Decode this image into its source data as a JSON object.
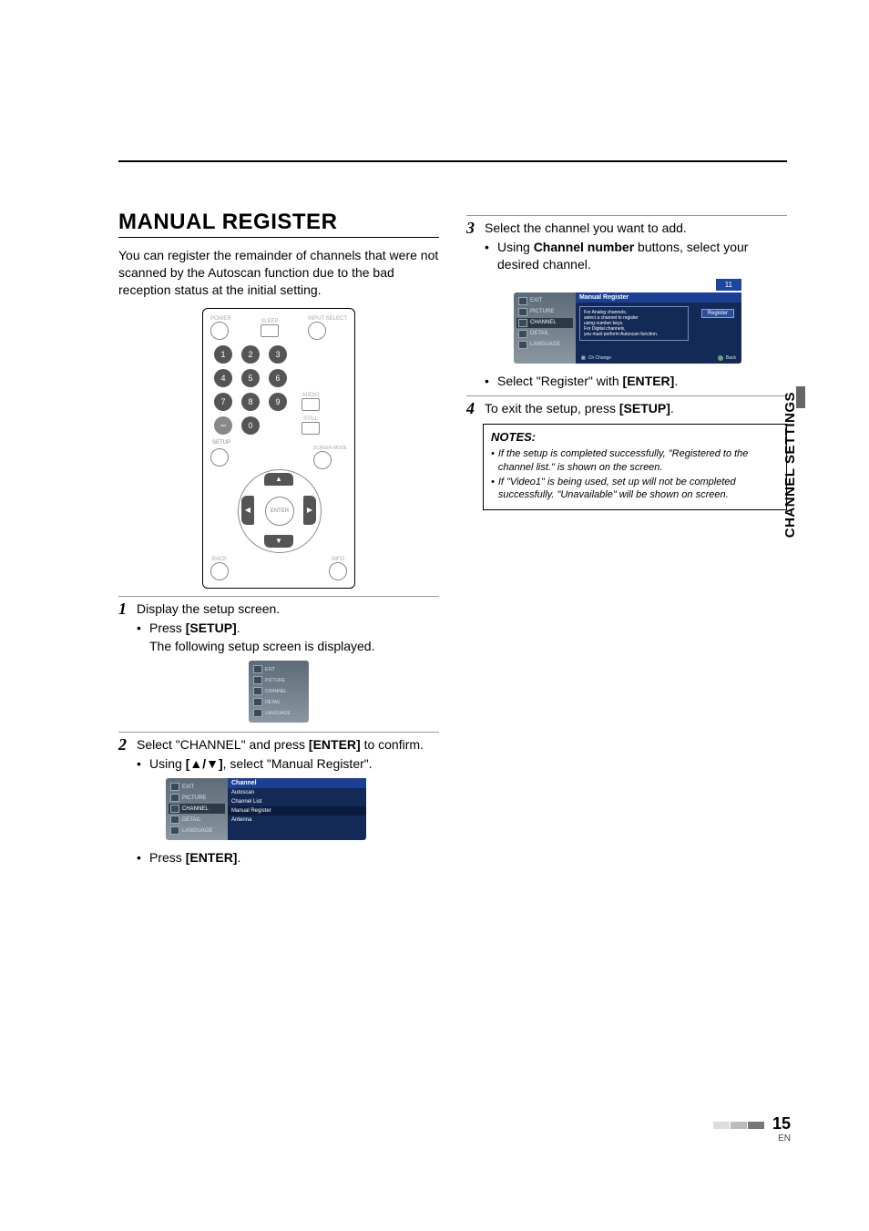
{
  "side_tab": "CHANNEL SETTINGS",
  "page": {
    "number": "15",
    "lang": "EN"
  },
  "title": "MANUAL REGISTER",
  "intro": "You can register the remainder of channels that were not scanned by the Autoscan function due to the bad reception status at the initial setting.",
  "remote": {
    "top_labels": {
      "power": "POWER",
      "sleep": "SLEEP",
      "input": "INPUT SELECT"
    },
    "nums": [
      "1",
      "2",
      "3",
      "4",
      "5",
      "6",
      "7",
      "8",
      "9",
      "0"
    ],
    "dash": "−",
    "audio": "AUDIO",
    "still": "STILL",
    "screen_mode": "SCREEN MODE",
    "setup": "SETUP",
    "enter": "ENTER",
    "back": "BACK",
    "info": "INFO"
  },
  "step1": {
    "text": "Display the setup screen.",
    "sub_pre": "Press ",
    "sub_btn": "[SETUP]",
    "sub_post": ".",
    "line2": "The following setup screen is displayed."
  },
  "mini_menu": [
    "EXIT",
    "PICTURE",
    "CHANNEL",
    "DETAIL",
    "LANGUAGE"
  ],
  "step2": {
    "text_pre": "Select \"CHANNEL\" and press ",
    "text_btn": "[ENTER]",
    "text_post": " to confirm.",
    "sub_pre": "Using ",
    "sub_btn": "[▲/▼]",
    "sub_post": ", select \"Manual Register\"."
  },
  "submenu": {
    "header": "Channel",
    "items": [
      "Autoscan",
      "Channel List",
      "Manual Register",
      "Antenna"
    ],
    "selected": "Manual Register"
  },
  "step2_end_pre": "Press ",
  "step2_end_btn": "[ENTER]",
  "step2_end_post": ".",
  "step3": {
    "text": "Select the channel you want to add.",
    "sub_pre": "Using ",
    "sub_btn": "Channel number",
    "sub_post": " buttons, select your desired channel."
  },
  "osd": {
    "channel_number": "11",
    "header": "Manual Register",
    "msg1": "For Analog channels,",
    "msg2": "select a channel to register",
    "msg3": "using number keys.",
    "msg4": "For Digital channels,",
    "msg5": "you must perform Autoscan function.",
    "register_btn": "Register",
    "foot_change": "Ch Change",
    "foot_back": "Back"
  },
  "step3b_pre": "Select \"Register\" with ",
  "step3b_btn": "[ENTER]",
  "step3b_post": ".",
  "step4_pre": "To exit the setup, press ",
  "step4_btn": "[SETUP]",
  "step4_post": ".",
  "notes": {
    "title": "NOTES:",
    "n1": "If the setup is completed successfully, \"Registered to the channel list.\" is shown on the screen.",
    "n2": "If \"Video1\" is being used, set up will not be completed successfully. \"Unavailable\" will be shown on screen."
  }
}
